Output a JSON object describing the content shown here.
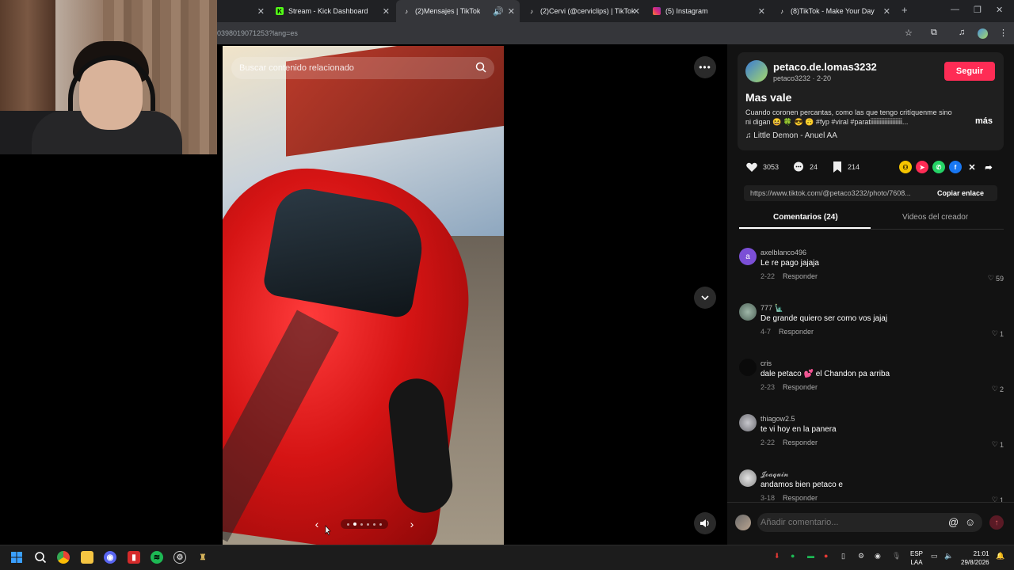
{
  "browser": {
    "tabs": [
      {
        "title": "Stream - Kick Dashboard",
        "favicon": "kick-icon",
        "active": false
      },
      {
        "title": "(2)Mensajes | TikTok",
        "favicon": "tiktok-icon",
        "active": true
      },
      {
        "title": "(2)Cervi (@cerviclips) | TikTok",
        "favicon": "tiktok-icon",
        "active": false
      },
      {
        "title": "(5) Instagram",
        "favicon": "instagram-icon",
        "active": false
      },
      {
        "title": "(8)TikTok - Make Your Day",
        "favicon": "tiktok-icon",
        "active": false
      }
    ],
    "new_tab": "+",
    "url": "0398019071253?lang=es"
  },
  "viewer": {
    "search_placeholder": "Buscar contenido relacionado",
    "more": "•••"
  },
  "post": {
    "username": "petaco.de.lomas3232",
    "handle_date": "petaco3232 · 2-20",
    "follow_label": "Seguir",
    "title": "Mas vale",
    "caption": "Cuando coronen percantas, como las que tengo critíquenme sino ni digan 😆 🍀 😎 🙃 #fyp #viral #parati̇i̇i̇i̇i̇i̇i̇i̇i̇i̇i̇i̇i̇i̇i̇i̇i̇i̇i̇i̇...",
    "more_label": "más",
    "music": "Little Demon - Anuel AA",
    "likes": "3053",
    "comments_count": "24",
    "saves": "214",
    "link": "https://www.tiktok.com/@petaco3232/photo/7608...",
    "copy_label": "Copiar enlace"
  },
  "tabs": {
    "comments": "Comentarios (24)",
    "creator_videos": "Videos del creador"
  },
  "comments": [
    {
      "user": "axelblanco496",
      "avatar_letter": "a",
      "avatar_color": "#7b4fd6",
      "text": "Le re pago jajaja",
      "date": "2-22",
      "reply": "Responder",
      "likes": "59"
    },
    {
      "user": "777 🗽",
      "avatar_letter": "",
      "avatar_color": "#6f8a7b",
      "text": "De grande quiero ser como vos jajaj",
      "date": "4-7",
      "reply": "Responder",
      "likes": "1"
    },
    {
      "user": "cris",
      "avatar_letter": "",
      "avatar_color": "#0a0a0a",
      "text": "dale petaco 💕 el Chandon pa arriba",
      "date": "2-23",
      "reply": "Responder",
      "likes": "2"
    },
    {
      "user": "thiagow2.5",
      "avatar_letter": "",
      "avatar_color": "#8d8d93",
      "text": "te vi hoy en la panera",
      "date": "2-22",
      "reply": "Responder",
      "likes": "1"
    },
    {
      "user": "𝓙𝓸𝓪𝓺𝓾𝓲𝓷",
      "avatar_letter": "",
      "avatar_color": "#b9b9b9",
      "text": "andamos bien petaco e",
      "date": "3-18",
      "reply": "Responder",
      "likes": "1"
    }
  ],
  "comment_input": {
    "placeholder": "Añadir comentario..."
  },
  "taskbar": {
    "lang_top": "ESP",
    "lang_bottom": "LAA",
    "time": "21:01",
    "date": "29/8/2026"
  }
}
